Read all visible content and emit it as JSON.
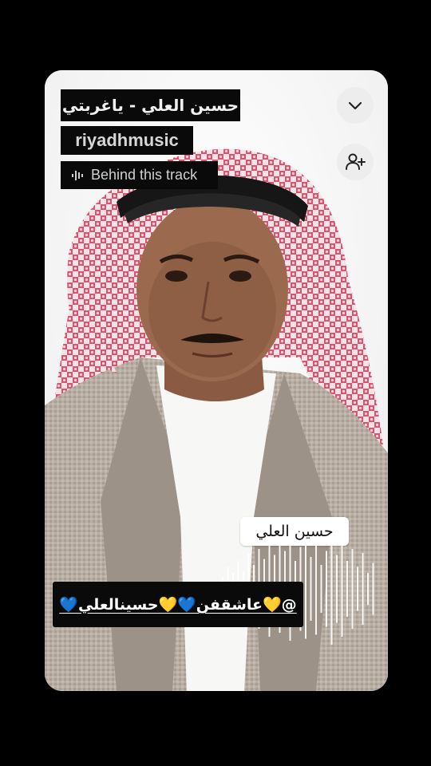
{
  "song": {
    "title": "حسين العلي - ياغربتي",
    "channel": "riyadhmusic"
  },
  "behind_track": {
    "label": "Behind this track",
    "icon": "sound-wave-icon"
  },
  "buttons": {
    "collapse_icon": "chevron-down-icon",
    "follow_icon": "add-user-icon"
  },
  "overlay": {
    "artist_caption": "حسين العلي",
    "mention": "@💛عاشقفن💙💛حسينالعلي💙"
  },
  "colors": {
    "background": "#000000",
    "tag_background": "#0a0a0a",
    "caption_background": "#ffffff",
    "accent_yellow": "#f5c518",
    "accent_blue": "#2a8cff"
  }
}
